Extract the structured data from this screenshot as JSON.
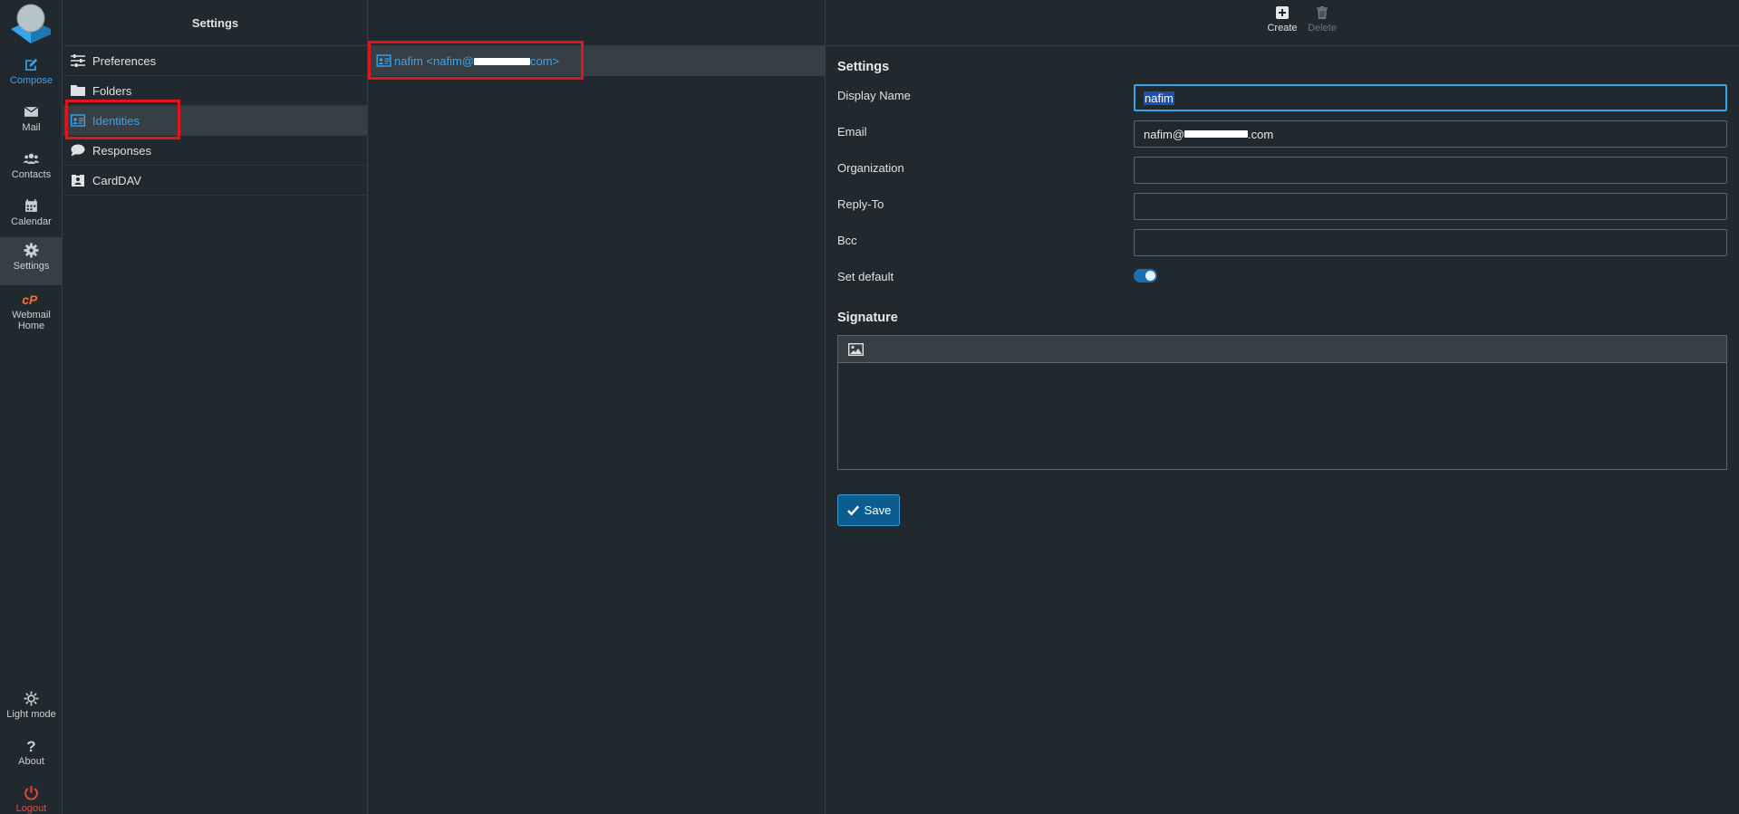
{
  "nav": {
    "compose": "Compose",
    "mail": "Mail",
    "contacts": "Contacts",
    "calendar": "Calendar",
    "settings": "Settings",
    "webmail_home_1": "Webmail",
    "webmail_home_2": "Home",
    "light_mode": "Light mode",
    "about": "About",
    "logout": "Logout"
  },
  "settings_list": {
    "title": "Settings",
    "items": [
      {
        "label": "Preferences",
        "icon": "sliders-icon"
      },
      {
        "label": "Folders",
        "icon": "folder-icon"
      },
      {
        "label": "Identities",
        "icon": "id-card-icon",
        "selected": true
      },
      {
        "label": "Responses",
        "icon": "comment-icon"
      },
      {
        "label": "CardDAV",
        "icon": "address-book-icon"
      }
    ]
  },
  "identities": {
    "item_prefix": "nafim <nafim@",
    "item_suffix": "com>"
  },
  "toolbar": {
    "create": "Create",
    "delete": "Delete"
  },
  "form": {
    "section_title": "Settings",
    "display_name_label": "Display Name",
    "display_name_value": "nafim",
    "email_label": "Email",
    "email_prefix": "nafim@",
    "email_suffix": ".com",
    "organization_label": "Organization",
    "reply_to_label": "Reply-To",
    "bcc_label": "Bcc",
    "set_default_label": "Set default",
    "set_default_on": true,
    "signature_title": "Signature",
    "save_label": "Save"
  },
  "colors": {
    "background": "#22292e",
    "accent": "#37a5ee",
    "highlight": "#e0161f",
    "logout": "#e74c3c"
  }
}
